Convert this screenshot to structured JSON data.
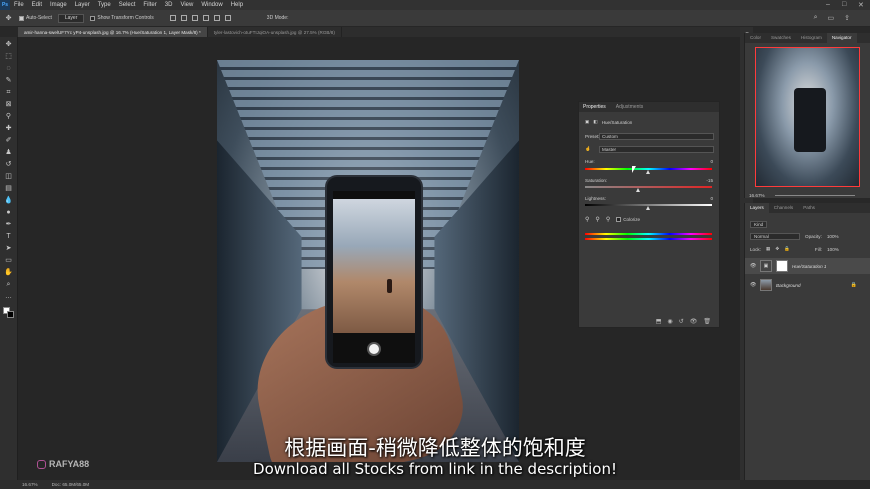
{
  "menu": [
    "File",
    "Edit",
    "Image",
    "Layer",
    "Type",
    "Select",
    "Filter",
    "3D",
    "View",
    "Window",
    "Help"
  ],
  "options": {
    "auto_select": "Auto-Select",
    "auto_select_target": "Layer",
    "show_transform": "Show Transform Controls",
    "mode_3d": "3D Mode:"
  },
  "tabs": [
    {
      "label": "amir-hanna-swelUF7Yc yP4-unsplash.jpg @ 16.7% (Hue/Saturation 1, Layer Mask/8) *",
      "active": true
    },
    {
      "label": "tyler-lastovich-otuFTIJqiOA-unsplash.jpg @ 27.5% (RGB/8)",
      "active": false
    }
  ],
  "properties": {
    "tab_properties": "Properties",
    "tab_adjustments": "Adjustments",
    "title": "Hue/Saturation",
    "preset_label": "Preset:",
    "preset_value": "Custom",
    "channel_value": "Master",
    "hue_label": "Hue:",
    "hue_value": "0",
    "saturation_label": "Saturation:",
    "saturation_value": "-15",
    "lightness_label": "Lightness:",
    "lightness_value": "0",
    "colorize_label": "Colorize"
  },
  "navigator": {
    "tabs": [
      "Color",
      "Swatches",
      "Histogram",
      "Navigator"
    ],
    "zoom": "16.67%"
  },
  "layers": {
    "tabs": [
      "Layers",
      "Channels",
      "Paths"
    ],
    "kind": "Kind",
    "blend_mode": "Normal",
    "opacity_label": "Opacity:",
    "opacity_value": "100%",
    "lock_label": "Lock:",
    "fill_label": "Fill:",
    "fill_value": "100%",
    "items": [
      {
        "name": "Hue/Saturation 1",
        "active": true
      },
      {
        "name": "Background",
        "active": false
      }
    ]
  },
  "status": {
    "zoom": "16.67%",
    "doc": "Doc: 65.0M/65.0M"
  },
  "overlay": {
    "subtitle_cn": "根据画面-稍微降低整体的饱和度",
    "subtitle_en": "Download all Stocks from link in the description!",
    "watermark": "RAFYA88"
  },
  "colors": {
    "accent_red": "#ff3b3b",
    "panel_bg": "#3a3a3a"
  }
}
